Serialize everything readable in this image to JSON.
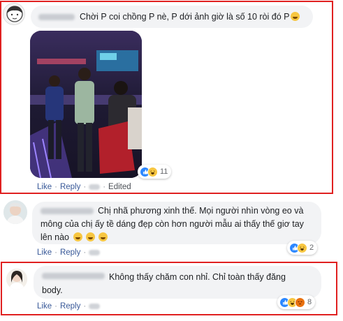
{
  "comments": [
    {
      "text": "Chời P coi chồng P nè, P dới ảnh giờ là số 10 ròi đó P",
      "actions": {
        "like": "Like",
        "reply": "Reply",
        "edited": "Edited"
      },
      "reactions": {
        "icons": [
          "like-icon",
          "haha-icon"
        ],
        "count": "11"
      }
    },
    {
      "text_line1": "Chị nhã phương xinh thế. Mọi người nhìn vòng eo và",
      "text_line2": "mông của chị ấy tề dáng đẹp còn hơn người mẫu ai thấy thế giơ tay",
      "text_line3": "lên nào",
      "actions": {
        "like": "Like",
        "reply": "Reply"
      },
      "reactions": {
        "icons": [
          "like-icon",
          "haha-icon"
        ],
        "count": "2"
      }
    },
    {
      "text_line1": "Không thấy chăm con nhỉ. Chỉ toàn thấy đăng",
      "text_line2": "body.",
      "actions": {
        "like": "Like",
        "reply": "Reply"
      },
      "reactions": {
        "icons": [
          "like-icon",
          "haha-icon",
          "angry-icon"
        ],
        "count": "8"
      }
    }
  ],
  "colors": {
    "bubble": "#f2f3f5",
    "link": "#385898",
    "highlight": "#e02020",
    "like": "#2d88ff",
    "haha": "#f7c641",
    "angry": "#e9710f"
  }
}
